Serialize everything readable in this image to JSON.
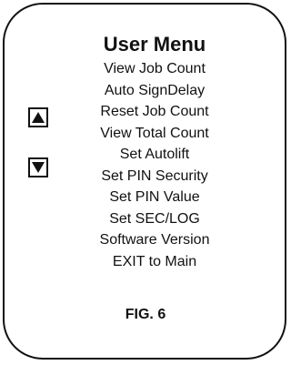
{
  "menu": {
    "title": "User Menu",
    "items": [
      "View Job Count",
      "Auto SignDelay",
      "Reset Job Count",
      "View Total Count",
      "Set Autolift",
      "Set PIN Security",
      "Set PIN Value",
      "Set SEC/LOG",
      "Software Version",
      "EXIT to Main"
    ]
  },
  "buttons": {
    "up_icon": "up-arrow-icon",
    "down_icon": "down-arrow-icon"
  },
  "figure": {
    "label": "FIG. 6"
  }
}
